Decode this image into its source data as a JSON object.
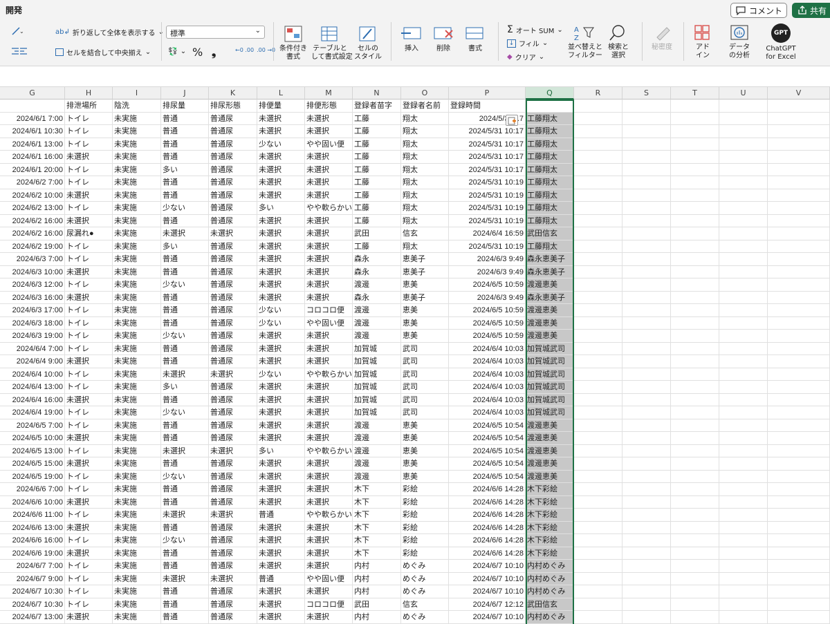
{
  "ribbon": {
    "tab": "開発",
    "comment": "コメント",
    "share": "共有",
    "wrap_text": "折り返して全体を表示する",
    "merge_center": "セルを結合して中央揃え",
    "number_format": "標準",
    "percent": "%",
    "comma": "❟",
    "conditional": "条件付き\n書式",
    "format_table": "テーブルと\nして書式設定",
    "cell_style": "セルの\nスタイル",
    "insert": "挿入",
    "delete": "削除",
    "format": "書式",
    "autosum": "オート SUM",
    "fill": "フィル",
    "clear": "クリア",
    "sort_filter": "並べ替えと\nフィルター",
    "find_select": "検索と\n選択",
    "sensitivity": "秘密度",
    "addin": "アド\nイン",
    "data_analysis": "データ\nの分析",
    "chatgpt": "ChatGPT\nfor Excel",
    "gpt_badge": "GPT"
  },
  "columns": [
    "G",
    "H",
    "I",
    "J",
    "K",
    "L",
    "M",
    "N",
    "O",
    "P",
    "Q",
    "R",
    "S",
    "T",
    "U",
    "V"
  ],
  "header_row": [
    "",
    "排泄場所",
    "陰洗",
    "排尿量",
    "排尿形態",
    "排便量",
    "排便形態",
    "登録者苗字",
    "登録者名前",
    "登録時間",
    ""
  ],
  "rows": [
    [
      "2024/6/1 7:00",
      "トイレ",
      "未実施",
      "普通",
      "普通尿",
      "未選択",
      "未選択",
      "工藤",
      "翔太",
      "2024/5/31 ..7",
      "工藤翔太"
    ],
    [
      "2024/6/1 10:30",
      "トイレ",
      "未実施",
      "普通",
      "普通尿",
      "未選択",
      "未選択",
      "工藤",
      "翔太",
      "2024/5/31 10:17",
      "工藤翔太"
    ],
    [
      "2024/6/1 13:00",
      "トイレ",
      "未実施",
      "普通",
      "普通尿",
      "少ない",
      "やや固い便",
      "工藤",
      "翔太",
      "2024/5/31 10:17",
      "工藤翔太"
    ],
    [
      "2024/6/1 16:00",
      "未選択",
      "未実施",
      "普通",
      "普通尿",
      "未選択",
      "未選択",
      "工藤",
      "翔太",
      "2024/5/31 10:17",
      "工藤翔太"
    ],
    [
      "2024/6/1 20:00",
      "トイレ",
      "未実施",
      "多い",
      "普通尿",
      "未選択",
      "未選択",
      "工藤",
      "翔太",
      "2024/5/31 10:17",
      "工藤翔太"
    ],
    [
      "2024/6/2 7:00",
      "トイレ",
      "未実施",
      "普通",
      "普通尿",
      "未選択",
      "未選択",
      "工藤",
      "翔太",
      "2024/5/31 10:19",
      "工藤翔太"
    ],
    [
      "2024/6/2 10:00",
      "未選択",
      "未実施",
      "普通",
      "普通尿",
      "未選択",
      "未選択",
      "工藤",
      "翔太",
      "2024/5/31 10:19",
      "工藤翔太"
    ],
    [
      "2024/6/2 13:00",
      "トイレ",
      "未実施",
      "少ない",
      "普通尿",
      "多い",
      "やや軟らかい",
      "工藤",
      "翔太",
      "2024/5/31 10:19",
      "工藤翔太"
    ],
    [
      "2024/6/2 16:00",
      "未選択",
      "未実施",
      "普通",
      "普通尿",
      "未選択",
      "未選択",
      "工藤",
      "翔太",
      "2024/5/31 10:19",
      "工藤翔太"
    ],
    [
      "2024/6/2 16:00",
      "尿漏れ●",
      "未実施",
      "未選択",
      "未選択",
      "未選択",
      "未選択",
      "武田",
      "信玄",
      "2024/6/4 16:59",
      "武田信玄"
    ],
    [
      "2024/6/2 19:00",
      "トイレ",
      "未実施",
      "多い",
      "普通尿",
      "未選択",
      "未選択",
      "工藤",
      "翔太",
      "2024/5/31 10:19",
      "工藤翔太"
    ],
    [
      "2024/6/3 7:00",
      "トイレ",
      "未実施",
      "普通",
      "普通尿",
      "未選択",
      "未選択",
      "森永",
      "恵美子",
      "2024/6/3 9:49",
      "森永恵美子"
    ],
    [
      "2024/6/3 10:00",
      "未選択",
      "未実施",
      "普通",
      "普通尿",
      "未選択",
      "未選択",
      "森永",
      "恵美子",
      "2024/6/3 9:49",
      "森永恵美子"
    ],
    [
      "2024/6/3 12:00",
      "トイレ",
      "未実施",
      "少ない",
      "普通尿",
      "未選択",
      "未選択",
      "渡邊",
      "恵美",
      "2024/6/5 10:59",
      "渡邊恵美"
    ],
    [
      "2024/6/3 16:00",
      "未選択",
      "未実施",
      "普通",
      "普通尿",
      "未選択",
      "未選択",
      "森永",
      "恵美子",
      "2024/6/3 9:49",
      "森永恵美子"
    ],
    [
      "2024/6/3 17:00",
      "トイレ",
      "未実施",
      "普通",
      "普通尿",
      "少ない",
      "コロコロ便",
      "渡邊",
      "恵美",
      "2024/6/5 10:59",
      "渡邊恵美"
    ],
    [
      "2024/6/3 18:00",
      "トイレ",
      "未実施",
      "普通",
      "普通尿",
      "少ない",
      "やや固い便",
      "渡邊",
      "恵美",
      "2024/6/5 10:59",
      "渡邊恵美"
    ],
    [
      "2024/6/3 19:00",
      "トイレ",
      "未実施",
      "少ない",
      "普通尿",
      "未選択",
      "未選択",
      "渡邊",
      "恵美",
      "2024/6/5 10:59",
      "渡邊恵美"
    ],
    [
      "2024/6/4 7:00",
      "トイレ",
      "未実施",
      "普通",
      "普通尿",
      "未選択",
      "未選択",
      "加賀城",
      "武司",
      "2024/6/4 10:03",
      "加賀城武司"
    ],
    [
      "2024/6/4 9:00",
      "未選択",
      "未実施",
      "普通",
      "普通尿",
      "未選択",
      "未選択",
      "加賀城",
      "武司",
      "2024/6/4 10:03",
      "加賀城武司"
    ],
    [
      "2024/6/4 10:00",
      "トイレ",
      "未実施",
      "未選択",
      "未選択",
      "少ない",
      "やや軟らかい",
      "加賀城",
      "武司",
      "2024/6/4 10:03",
      "加賀城武司"
    ],
    [
      "2024/6/4 13:00",
      "トイレ",
      "未実施",
      "多い",
      "普通尿",
      "未選択",
      "未選択",
      "加賀城",
      "武司",
      "2024/6/4 10:03",
      "加賀城武司"
    ],
    [
      "2024/6/4 16:00",
      "未選択",
      "未実施",
      "普通",
      "普通尿",
      "未選択",
      "未選択",
      "加賀城",
      "武司",
      "2024/6/4 10:03",
      "加賀城武司"
    ],
    [
      "2024/6/4 19:00",
      "トイレ",
      "未実施",
      "少ない",
      "普通尿",
      "未選択",
      "未選択",
      "加賀城",
      "武司",
      "2024/6/4 10:03",
      "加賀城武司"
    ],
    [
      "2024/6/5 7:00",
      "トイレ",
      "未実施",
      "普通",
      "普通尿",
      "未選択",
      "未選択",
      "渡邊",
      "恵美",
      "2024/6/5 10:54",
      "渡邊恵美"
    ],
    [
      "2024/6/5 10:00",
      "未選択",
      "未実施",
      "普通",
      "普通尿",
      "未選択",
      "未選択",
      "渡邊",
      "恵美",
      "2024/6/5 10:54",
      "渡邊恵美"
    ],
    [
      "2024/6/5 13:00",
      "トイレ",
      "未実施",
      "未選択",
      "未選択",
      "多い",
      "やや軟らかい",
      "渡邊",
      "恵美",
      "2024/6/5 10:54",
      "渡邊恵美"
    ],
    [
      "2024/6/5 15:00",
      "未選択",
      "未実施",
      "普通",
      "普通尿",
      "未選択",
      "未選択",
      "渡邊",
      "恵美",
      "2024/6/5 10:54",
      "渡邊恵美"
    ],
    [
      "2024/6/5 19:00",
      "トイレ",
      "未実施",
      "少ない",
      "普通尿",
      "未選択",
      "未選択",
      "渡邊",
      "恵美",
      "2024/6/5 10:54",
      "渡邊恵美"
    ],
    [
      "2024/6/6 7:00",
      "トイレ",
      "未実施",
      "普通",
      "普通尿",
      "未選択",
      "未選択",
      "木下",
      "彩絵",
      "2024/6/6 14:28",
      "木下彩絵"
    ],
    [
      "2024/6/6 10:00",
      "未選択",
      "未実施",
      "普通",
      "普通尿",
      "未選択",
      "未選択",
      "木下",
      "彩絵",
      "2024/6/6 14:28",
      "木下彩絵"
    ],
    [
      "2024/6/6 11:00",
      "トイレ",
      "未実施",
      "未選択",
      "未選択",
      "普通",
      "やや軟らかい",
      "木下",
      "彩絵",
      "2024/6/6 14:28",
      "木下彩絵"
    ],
    [
      "2024/6/6 13:00",
      "未選択",
      "未実施",
      "普通",
      "普通尿",
      "未選択",
      "未選択",
      "木下",
      "彩絵",
      "2024/6/6 14:28",
      "木下彩絵"
    ],
    [
      "2024/6/6 16:00",
      "トイレ",
      "未実施",
      "少ない",
      "普通尿",
      "未選択",
      "未選択",
      "木下",
      "彩絵",
      "2024/6/6 14:28",
      "木下彩絵"
    ],
    [
      "2024/6/6 19:00",
      "未選択",
      "未実施",
      "普通",
      "普通尿",
      "未選択",
      "未選択",
      "木下",
      "彩絵",
      "2024/6/6 14:28",
      "木下彩絵"
    ],
    [
      "2024/6/7 7:00",
      "トイレ",
      "未実施",
      "普通",
      "普通尿",
      "未選択",
      "未選択",
      "内村",
      "めぐみ",
      "2024/6/7 10:10",
      "内村めぐみ"
    ],
    [
      "2024/6/7 9:00",
      "トイレ",
      "未実施",
      "未選択",
      "未選択",
      "普通",
      "やや固い便",
      "内村",
      "めぐみ",
      "2024/6/7 10:10",
      "内村めぐみ"
    ],
    [
      "2024/6/7 10:30",
      "トイレ",
      "未実施",
      "普通",
      "普通尿",
      "未選択",
      "未選択",
      "内村",
      "めぐみ",
      "2024/6/7 10:10",
      "内村めぐみ"
    ],
    [
      "2024/6/7 10:30",
      "トイレ",
      "未実施",
      "普通",
      "普通尿",
      "未選択",
      "コロコロ便",
      "武田",
      "信玄",
      "2024/6/7 12:12",
      "武田信玄"
    ],
    [
      "2024/6/7 13:00",
      "未選択",
      "未実施",
      "普通",
      "普通尿",
      "未選択",
      "未選択",
      "内村",
      "めぐみ",
      "2024/6/7 10:10",
      "内村めぐみ"
    ]
  ],
  "colors": {
    "accent": "#1e7145",
    "selected_col": "#c8c8c8",
    "header_bg": "#f0f0f0"
  }
}
